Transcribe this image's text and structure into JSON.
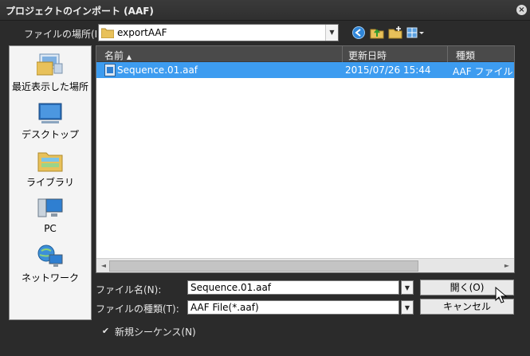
{
  "window": {
    "title": "プロジェクトのインポート (AAF)",
    "close_glyph": "×"
  },
  "lookin": {
    "label": "ファイルの場所(I):",
    "value": "exportAAF",
    "arrow": "▼"
  },
  "places": [
    {
      "icon": "recent-places-icon",
      "label": "最近表示した場所"
    },
    {
      "icon": "desktop-icon",
      "label": "デスクトップ"
    },
    {
      "icon": "libraries-icon",
      "label": "ライブラリ"
    },
    {
      "icon": "computer-icon",
      "label": "PC"
    },
    {
      "icon": "network-icon",
      "label": "ネットワーク"
    }
  ],
  "columns": {
    "name": "名前",
    "sort_glyph": "▲",
    "modified": "更新日時",
    "type": "種類"
  },
  "files": [
    {
      "name": "Sequence.01.aaf",
      "modified": "2015/07/26 15:44",
      "type": "AAF ファイル",
      "selected": true
    }
  ],
  "scroll": {
    "left": "◄",
    "right": "►"
  },
  "filename": {
    "label": "ファイル名(N):",
    "value": "Sequence.01.aaf",
    "arrow": "▼"
  },
  "filetype": {
    "label": "ファイルの種類(T):",
    "value": "AAF File(*.aaf)",
    "arrow": "▼"
  },
  "buttons": {
    "open": "開く(O)",
    "cancel": "キャンセル"
  },
  "new_sequence": {
    "label": "新規シーケンス(N)",
    "checked": true,
    "check_glyph": "✔"
  },
  "colors": {
    "selection": "#3d9cf0",
    "background": "#2b2b2b"
  }
}
